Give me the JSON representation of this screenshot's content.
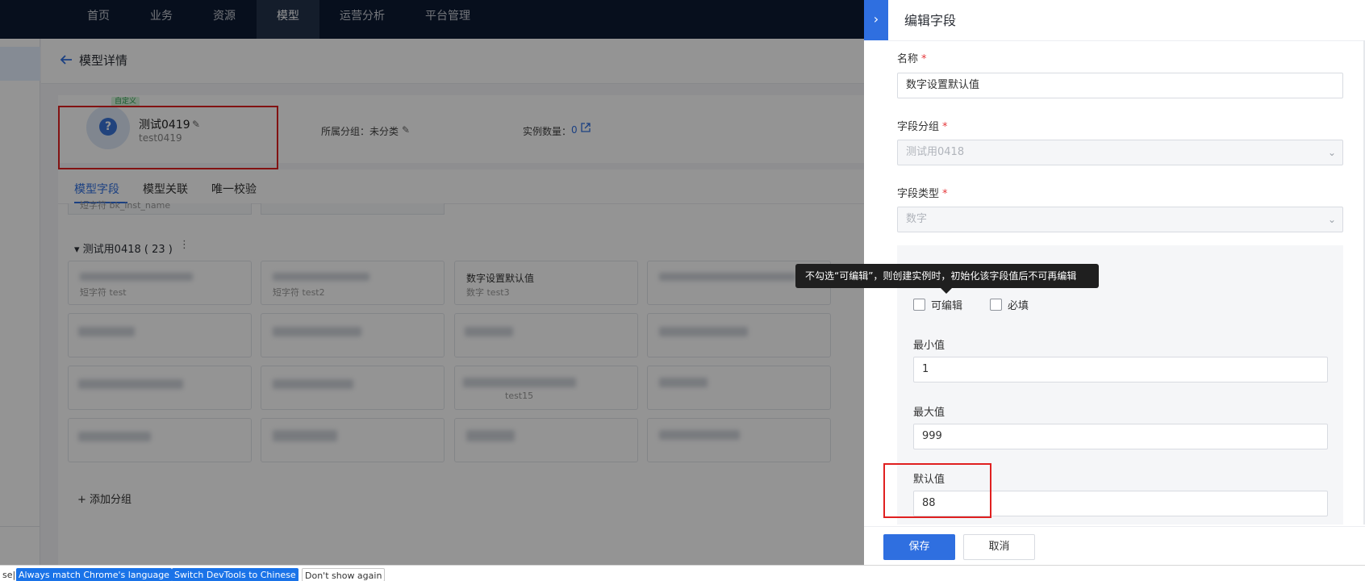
{
  "topnav": {
    "items": [
      {
        "label": "首页"
      },
      {
        "label": "业务"
      },
      {
        "label": "资源"
      },
      {
        "label": "模型"
      },
      {
        "label": "运营分析"
      },
      {
        "label": "平台管理"
      }
    ],
    "active_index": 3
  },
  "page": {
    "title": "模型详情"
  },
  "model": {
    "tag": "自定义",
    "name": "测试0419",
    "id": "test0419",
    "group_label": "所属分组：未分类",
    "instance_count_label": "实例数量：",
    "instance_count": "0"
  },
  "tabs": [
    {
      "label": "模型字段"
    },
    {
      "label": "模型关联"
    },
    {
      "label": "唯一校验"
    }
  ],
  "field_group": {
    "title": "测试用0418 ( 23 )",
    "partial_top_text": "短字符  bk_inst_name",
    "visible_field": {
      "name": "数字设置默认值",
      "sub": "数字  test3"
    },
    "row1_card1_sub": "短字符  test",
    "row1_card2_sub": "短字符  test2",
    "row3_card3_sub": "test15",
    "add_group": "添加分组"
  },
  "drawer": {
    "title": "编辑字段",
    "name_label": "名称",
    "name_value": "数字设置默认值",
    "group_label": "字段分组",
    "group_value": "测试用0418",
    "type_label": "字段类型",
    "type_value": "数字",
    "editable_label": "可编辑",
    "required_label": "必填",
    "min_label": "最小值",
    "min_value": "1",
    "max_label": "最大值",
    "max_value": "999",
    "default_label": "默认值",
    "default_value": "88",
    "save_label": "保存",
    "cancel_label": "取消",
    "required_mark": "*"
  },
  "tooltip": {
    "text": "不勾选“可编辑”，则创建实例时，初始化该字段值后不可再编辑"
  },
  "devtools_bar": {
    "left_fragment": "se|",
    "btn_match": "Always match Chrome's language",
    "btn_switch": "Switch DevTools to Chinese",
    "btn_dont_show": "Don't show again"
  },
  "colors": {
    "nav_bg": "#0d1b33",
    "accent": "#2f6fe0",
    "highlight_red": "#e02020"
  }
}
